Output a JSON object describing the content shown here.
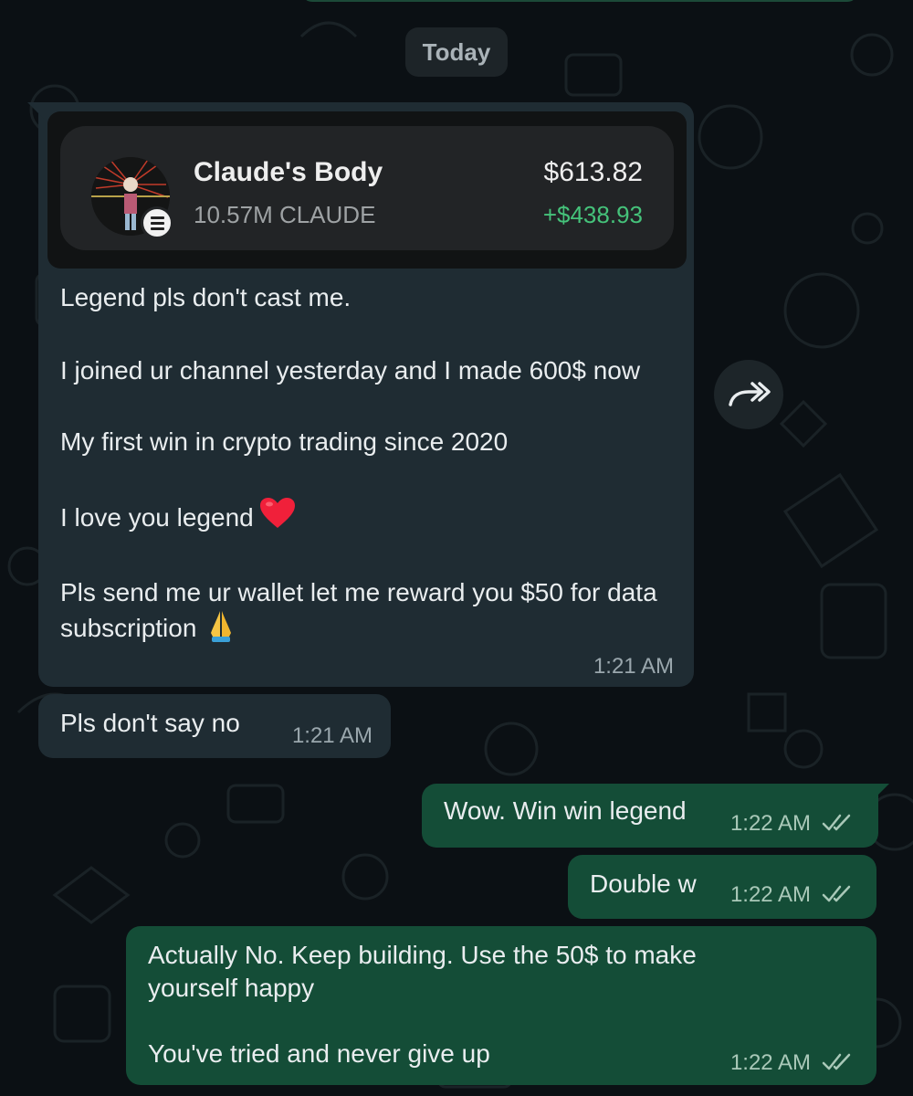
{
  "date_label": "Today",
  "colors": {
    "background": "#0b1014",
    "incoming_bubble": "#1f2c33",
    "outgoing_bubble": "#144d37",
    "positive_change": "#45c27a",
    "read_ticks": "#a9c8b8"
  },
  "incoming": [
    {
      "shared_card": {
        "token_name": "Claude's Body",
        "token_amount": "10.57M CLAUDE",
        "value": "$613.82",
        "change": "+$438.93",
        "badge_icon": "solana-icon"
      },
      "paragraphs": [
        "Legend pls don't cast me.",
        "I joined ur channel yesterday  and I made 600$ now",
        "My first win in crypto  trading since 2020",
        "I love you legend",
        "Pls send me ur wallet let me reward  you $50 for data subscription"
      ],
      "time": "1:21 AM"
    },
    {
      "text": "Pls don't say no",
      "time": "1:21 AM"
    }
  ],
  "outgoing": [
    {
      "text": "Wow. Win win legend",
      "time": "1:22 AM",
      "status_icon": "double-check-icon"
    },
    {
      "text": "Double w",
      "time": "1:22 AM",
      "status_icon": "double-check-icon"
    },
    {
      "paragraphs": [
        "Actually  No. Keep building.  Use the 50$ to make yourself  happy",
        "You've tried and never give up"
      ],
      "time": "1:22 AM",
      "status_icon": "double-check-icon"
    }
  ],
  "forward_icon": "forward-icon"
}
